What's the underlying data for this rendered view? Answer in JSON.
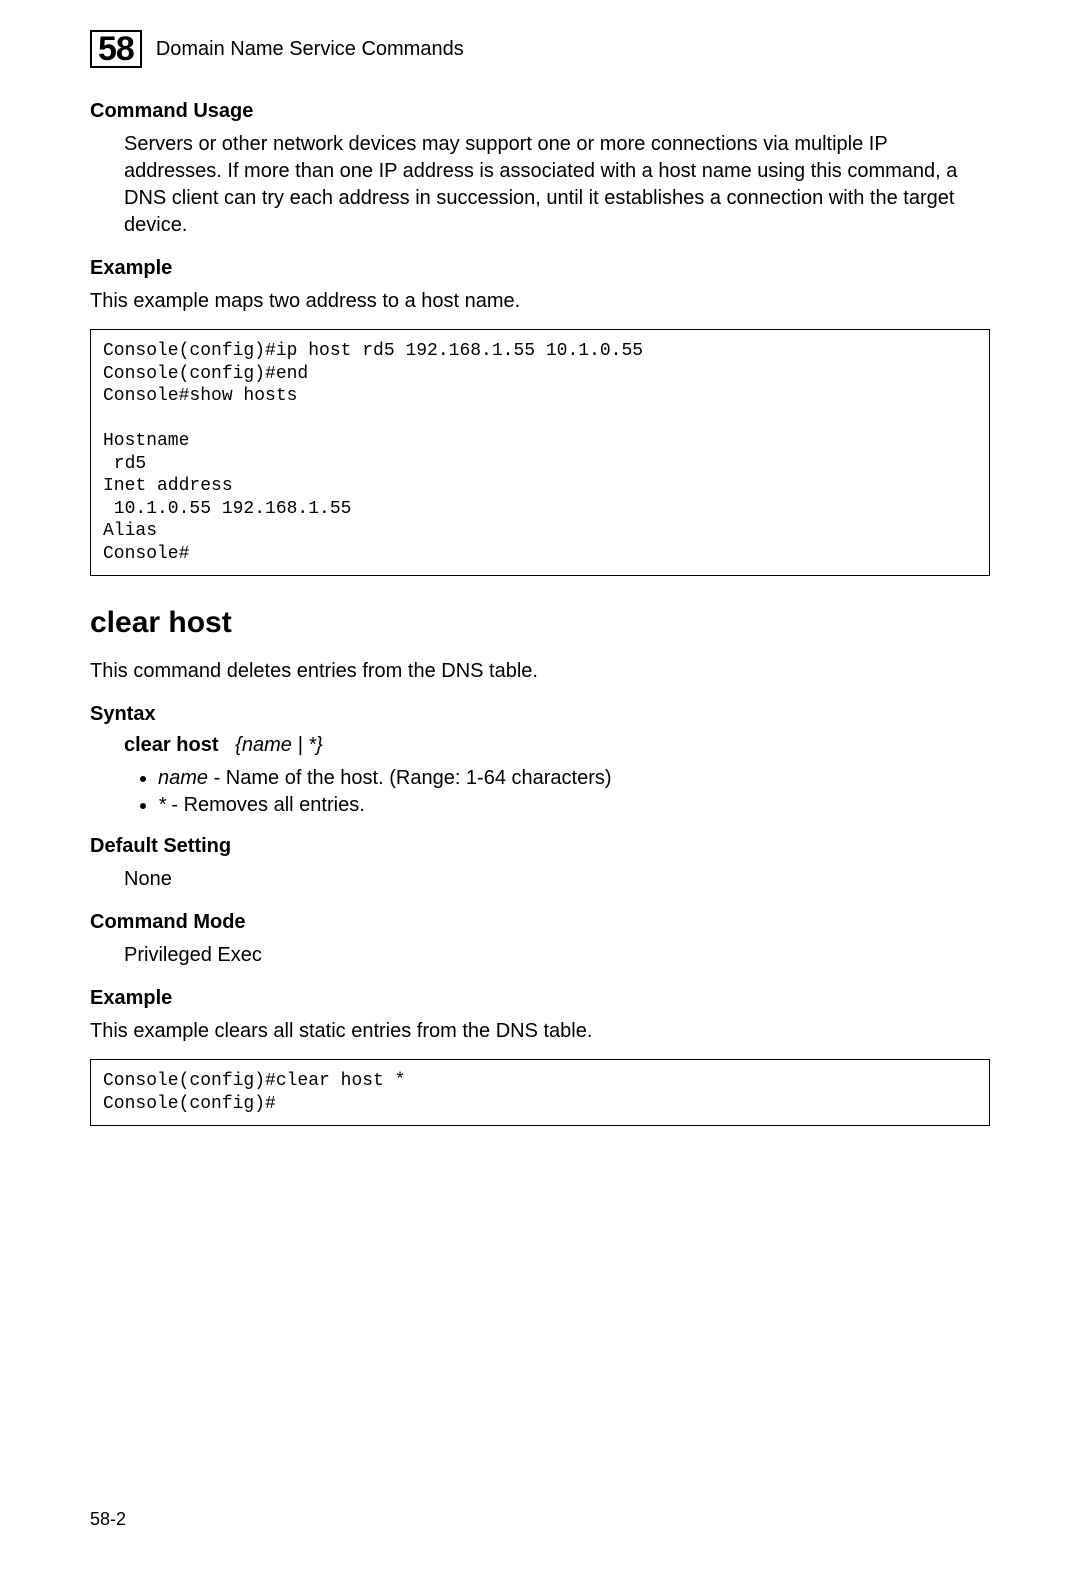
{
  "header": {
    "chapter_number": "58",
    "chapter_title": "Domain Name Service Commands"
  },
  "section1": {
    "usage_label": "Command Usage",
    "usage_text": "Servers or other network devices may support one or more connections via multiple IP addresses. If more than one IP address is associated with a host name using this command, a DNS client can try each address in succession, until it establishes a connection with the target device.",
    "example_label": "Example",
    "example_intro": "This example maps two address to a host name.",
    "example_code": "Console(config)#ip host rd5 192.168.1.55 10.1.0.55\nConsole(config)#end\nConsole#show hosts\n\nHostname\n rd5\nInet address\n 10.1.0.55 192.168.1.55\nAlias\nConsole#"
  },
  "section2": {
    "heading": "clear host",
    "description": "This command deletes entries from the DNS table.",
    "syntax_label": "Syntax",
    "syntax_cmd": "clear host",
    "syntax_args": "{name | *}",
    "params": [
      {
        "name": "name",
        "desc": " - Name of the host. (Range: 1-64 characters)"
      },
      {
        "name": "*",
        "desc": " - Removes all entries."
      }
    ],
    "default_label": "Default Setting",
    "default_value": "None",
    "mode_label": "Command Mode",
    "mode_value": "Privileged Exec",
    "example_label": "Example",
    "example_intro": "This example clears all static entries from the DNS table.",
    "example_code": "Console(config)#clear host *\nConsole(config)#"
  },
  "footer": {
    "page_number": "58-2"
  }
}
